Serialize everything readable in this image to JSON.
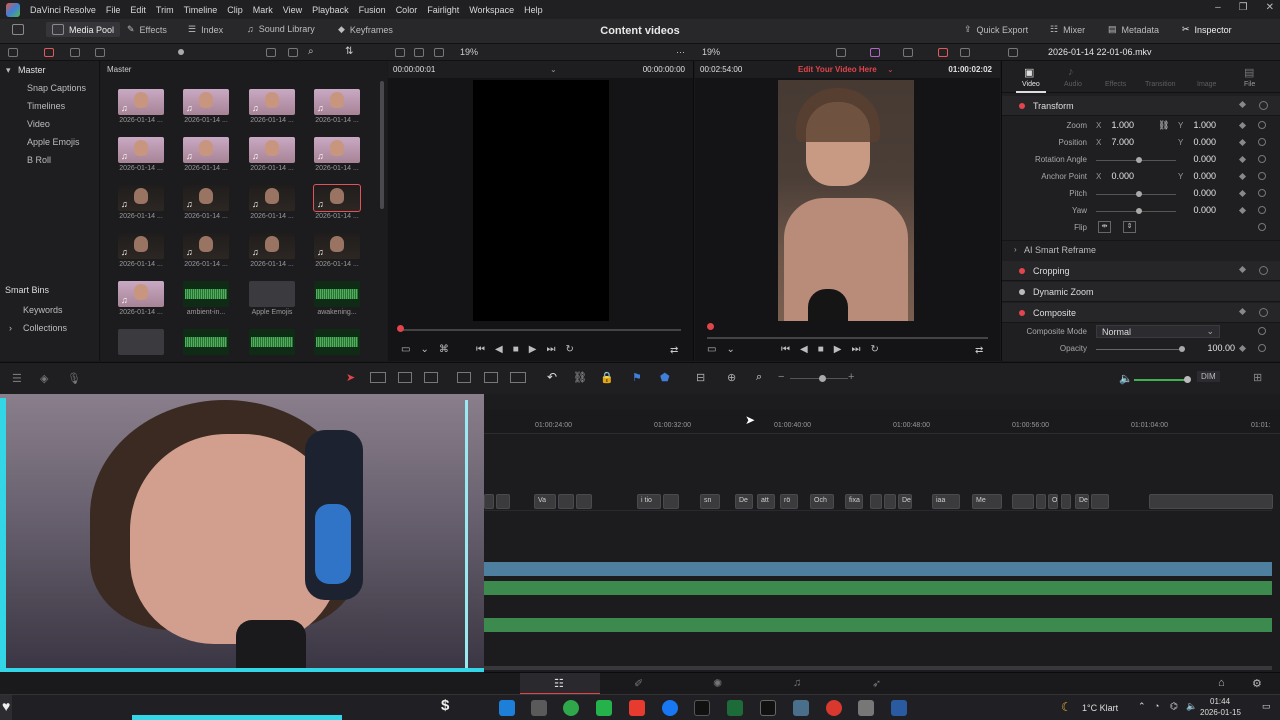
{
  "app": {
    "name": "DaVinci Resolve",
    "menu": [
      "File",
      "Edit",
      "Trim",
      "Timeline",
      "Clip",
      "Mark",
      "View",
      "Playback",
      "Fusion",
      "Color",
      "Fairlight",
      "Workspace",
      "Help"
    ]
  },
  "toolbar": {
    "media_pool": "Media Pool",
    "effects": "Effects",
    "index": "Index",
    "sound_library": "Sound Library",
    "keyframes": "Keyframes",
    "project_title": "Content videos",
    "quick_export": "Quick Export",
    "mixer": "Mixer",
    "metadata": "Metadata",
    "inspector": "Inspector"
  },
  "subbar": {
    "zoom_left": "19%",
    "zoom_right": "19%",
    "clip_name": "2026-01-14 22-01-06.mkv"
  },
  "bins": {
    "master": "Master",
    "items": [
      "Snap Captions",
      "Timelines",
      "Video",
      "Apple Emojis",
      "B Roll"
    ],
    "smart_bins": "Smart Bins",
    "smart_items": [
      "Keywords",
      "Collections"
    ]
  },
  "pool": {
    "header": "Master",
    "clips": [
      {
        "label": "2026-01-14 ...",
        "kind": "lav"
      },
      {
        "label": "2026-01-14 ...",
        "kind": "lav"
      },
      {
        "label": "2026-01-14 ...",
        "kind": "lav"
      },
      {
        "label": "2026-01-14 ...",
        "kind": "lav"
      },
      {
        "label": "2026-01-14 ...",
        "kind": "lav"
      },
      {
        "label": "2026-01-14 ...",
        "kind": "lav"
      },
      {
        "label": "2026-01-14 ...",
        "kind": "lav"
      },
      {
        "label": "2026-01-14 ...",
        "kind": "lav"
      },
      {
        "label": "2026-01-14 ...",
        "kind": "dark"
      },
      {
        "label": "2026-01-14 ...",
        "kind": "dark"
      },
      {
        "label": "2026-01-14 ...",
        "kind": "dark"
      },
      {
        "label": "2026-01-14 ...",
        "kind": "dark-sel"
      },
      {
        "label": "2026-01-14 ...",
        "kind": "dark"
      },
      {
        "label": "2026-01-14 ...",
        "kind": "dark"
      },
      {
        "label": "2026-01-14 ...",
        "kind": "dark"
      },
      {
        "label": "2026-01-14 ...",
        "kind": "dark"
      },
      {
        "label": "2026-01-14 ...",
        "kind": "lav"
      },
      {
        "label": "ambient-in...",
        "kind": "wave"
      },
      {
        "label": "Apple Emojis",
        "kind": "folder"
      },
      {
        "label": "awakening...",
        "kind": "wave"
      },
      {
        "label": "",
        "kind": "folder"
      },
      {
        "label": "",
        "kind": "wave"
      },
      {
        "label": "",
        "kind": "wave"
      },
      {
        "label": "",
        "kind": "wave"
      }
    ]
  },
  "source_viewer": {
    "timecode_left": "00:00:00:01",
    "timecode_right": "00:00:00:00"
  },
  "timeline_viewer": {
    "duration": "00:02:54:00",
    "timeline_name": "Edit Your Video Here",
    "timecode": "01:00:02:02"
  },
  "inspector": {
    "tabs": [
      "Video",
      "Audio",
      "Effects",
      "Transition",
      "Image",
      "File"
    ],
    "transform": {
      "title": "Transform",
      "zoom_label": "Zoom",
      "zoom_x": "1.000",
      "zoom_y": "1.000",
      "position_label": "Position",
      "position_x": "7.000",
      "position_y": "0.000",
      "rotation_label": "Rotation Angle",
      "rotation": "0.000",
      "anchor_label": "Anchor Point",
      "anchor_x": "0.000",
      "anchor_y": "0.000",
      "pitch_label": "Pitch",
      "pitch": "0.000",
      "yaw_label": "Yaw",
      "yaw": "0.000",
      "flip_label": "Flip",
      "x_axis": "X",
      "y_axis": "Y"
    },
    "ai_reframe": "AI Smart Reframe",
    "cropping": "Cropping",
    "dynamic_zoom": "Dynamic Zoom",
    "composite": {
      "title": "Composite",
      "mode_label": "Composite Mode",
      "mode": "Normal",
      "opacity_label": "Opacity",
      "opacity": "100.00"
    }
  },
  "timeline": {
    "dim": "DIM",
    "ruler": [
      "01:00:24:00",
      "01:00:32:00",
      "01:00:40:00",
      "01:00:48:00",
      "01:00:56:00",
      "01:01:04:00",
      "01:01:"
    ],
    "captions": [
      "",
      "",
      "Va",
      "",
      "",
      "i tio",
      "",
      "sn",
      "De",
      "att",
      "rö",
      "Och",
      "fixa",
      "",
      "",
      "Det",
      "iaa",
      "Me",
      "",
      "",
      "O",
      "",
      "Det är okej."
    ]
  },
  "taskbar": {
    "weather": "1°C  Klart",
    "time": "01:44",
    "date": "2026-01-15"
  }
}
